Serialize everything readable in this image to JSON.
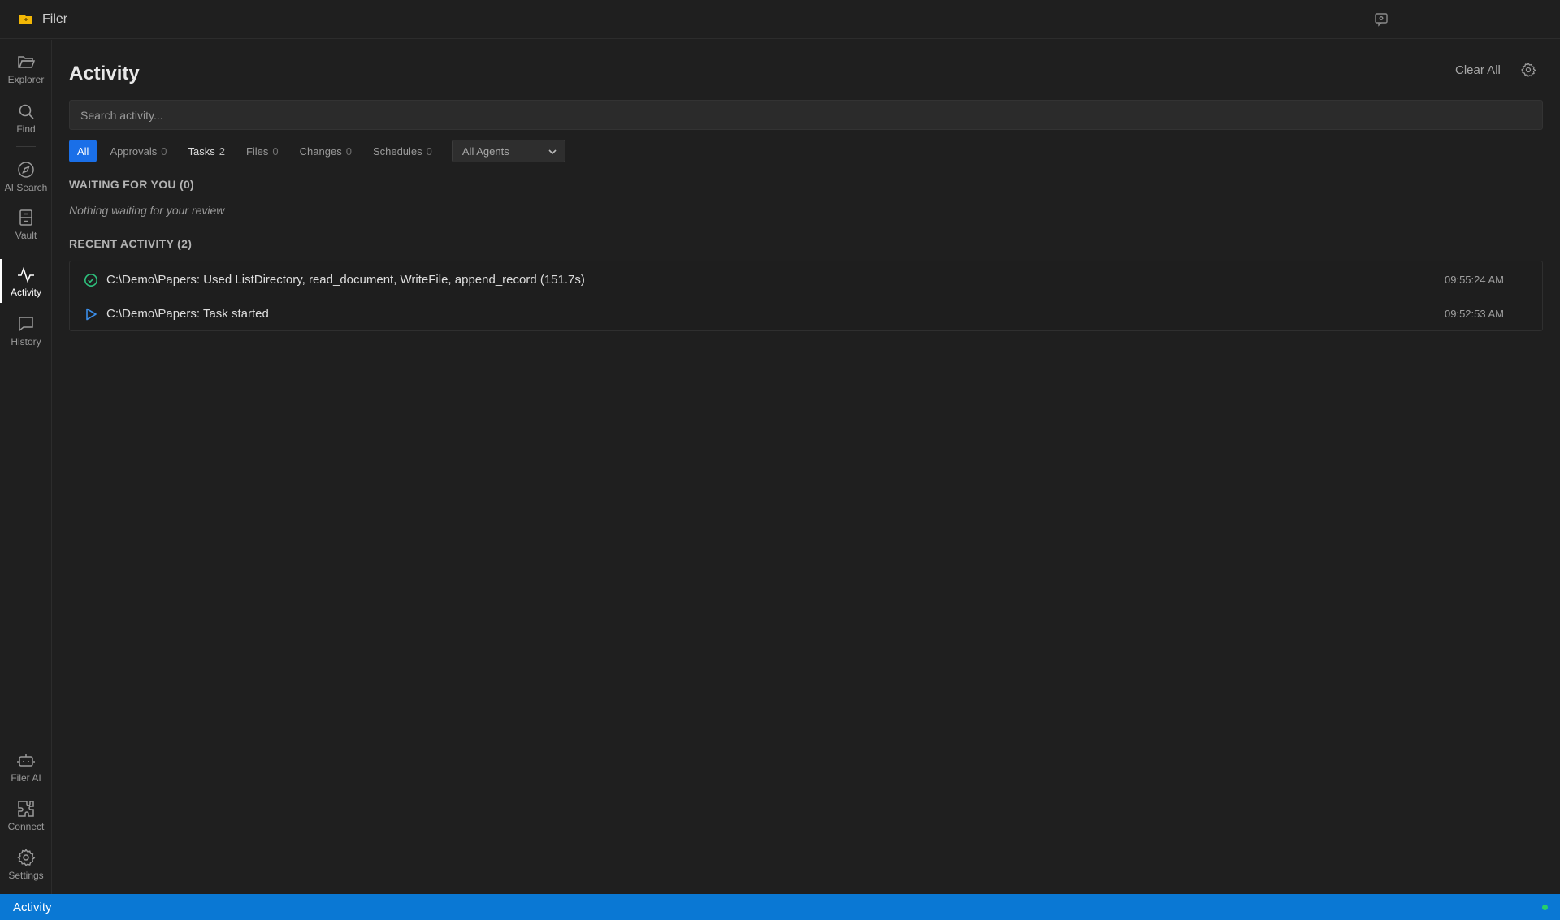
{
  "app": {
    "title": "Filer"
  },
  "sidebar": {
    "items": [
      {
        "label": "Explorer",
        "icon": "folder-open-icon"
      },
      {
        "label": "Find",
        "icon": "search-icon"
      },
      {
        "label": "AI Search",
        "icon": "compass-icon"
      },
      {
        "label": "Vault",
        "icon": "archive-icon"
      },
      {
        "label": "Activity",
        "icon": "activity-pulse-icon",
        "active": true
      },
      {
        "label": "History",
        "icon": "chat-bubble-icon"
      }
    ],
    "bottom_items": [
      {
        "label": "Filer AI",
        "icon": "robot-icon"
      },
      {
        "label": "Connect",
        "icon": "puzzle-icon"
      },
      {
        "label": "Settings",
        "icon": "gear-icon"
      }
    ]
  },
  "header": {
    "title": "Activity",
    "clear_all": "Clear All"
  },
  "search": {
    "placeholder": "Search activity..."
  },
  "filters": [
    {
      "label": "All",
      "count": ""
    },
    {
      "label": "Approvals",
      "count": "0"
    },
    {
      "label": "Tasks",
      "count": "2"
    },
    {
      "label": "Files",
      "count": "0"
    },
    {
      "label": "Changes",
      "count": "0"
    },
    {
      "label": "Schedules",
      "count": "0"
    }
  ],
  "agent_filter": {
    "selected": "All Agents"
  },
  "waiting": {
    "heading": "WAITING FOR YOU (0)",
    "empty": "Nothing waiting for your review"
  },
  "recent": {
    "heading": "RECENT ACTIVITY (2)",
    "items": [
      {
        "status": "completed",
        "text": "C:\\Demo\\Papers: Used ListDirectory, read_document, WriteFile, append_record (151.7s)",
        "time": "09:55:24 AM"
      },
      {
        "status": "started",
        "text": "C:\\Demo\\Papers: Task started",
        "time": "09:52:53 AM"
      }
    ]
  },
  "status_bar": {
    "label": "Activity",
    "indicator_color": "#27d06b"
  },
  "colors": {
    "accent": "#1a6fe8",
    "status_bar": "#0a78d4",
    "success": "#2ec27e",
    "started": "#3b8eea"
  }
}
